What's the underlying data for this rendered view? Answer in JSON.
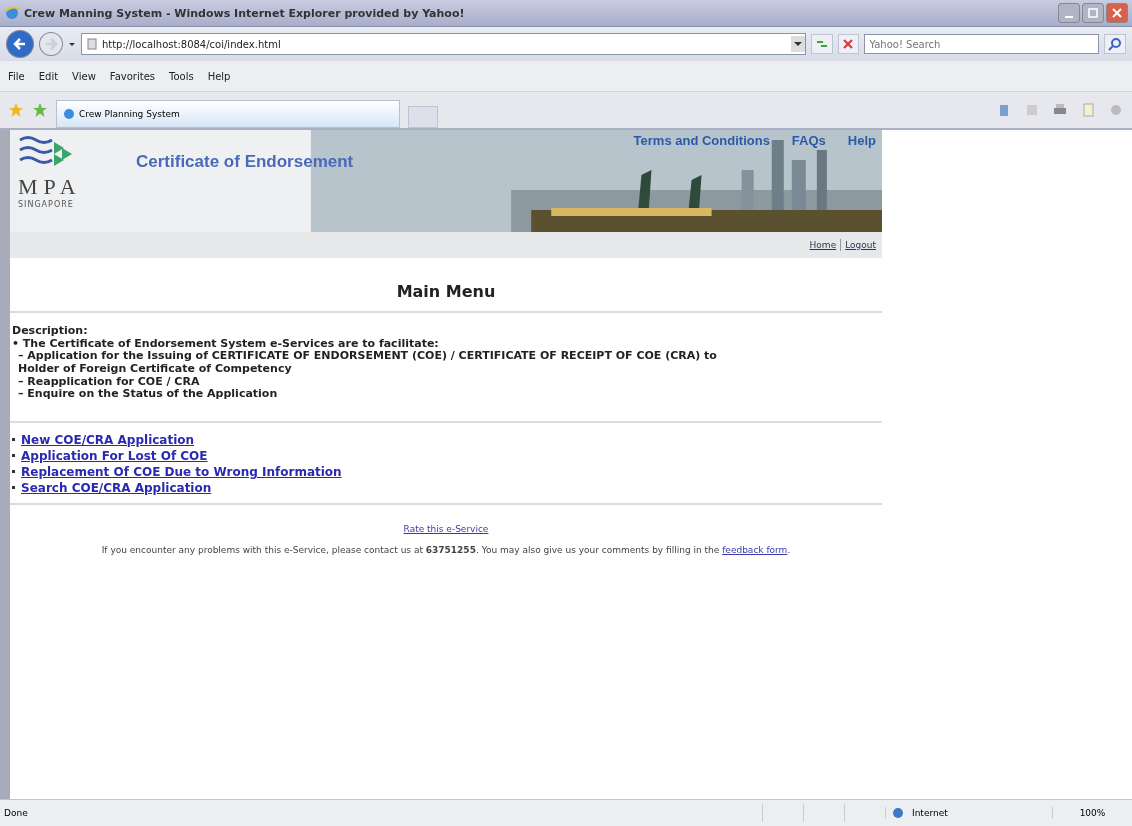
{
  "window": {
    "title": "Crew Manning System - Windows Internet Explorer provided by Yahoo!"
  },
  "address_bar": {
    "url": "http://localhost:8084/coi/index.html"
  },
  "search": {
    "placeholder": "Yahoo! Search"
  },
  "menu": [
    "File",
    "Edit",
    "View",
    "Favorites",
    "Tools",
    "Help"
  ],
  "tabs": [
    {
      "label": "Crew Planning System",
      "selected": true
    }
  ],
  "banner": {
    "logo_text": "MPA",
    "logo_subtext": "SINGAPORE",
    "title": "Certificate of Endorsement",
    "links": [
      "Terms and Conditions",
      "FAQs",
      "Help"
    ]
  },
  "nav_links": [
    "Home",
    "Logout"
  ],
  "heading": "Main Menu",
  "description": {
    "label": "Description:",
    "intro": "• The Certificate of Endorsement System e-Services are to facilitate:",
    "items": [
      "– Application for the Issuing of CERTIFICATE OF ENDORSEMENT (COE) / CERTIFICATE OF RECEIPT OF COE (CRA) to Holder of Foreign Certificate of Competency",
      "– Reapplication for COE / CRA",
      "– Enquire on the Status of the Application"
    ]
  },
  "menu_links": [
    "New COE/CRA Application",
    "Application For Lost Of COE",
    "Replacement Of COE Due to Wrong Information",
    "Search COE/CRA Application"
  ],
  "rate_link": "Rate this e-Service",
  "contact": {
    "before": "If you encounter any problems with this e-Service, please contact us at **63751255**. You may also give us your comments by filling in the",
    "link": "feedback form",
    "after": "."
  },
  "status_bar": {
    "status": "Done",
    "zone": "Internet",
    "zoom": "100%"
  }
}
